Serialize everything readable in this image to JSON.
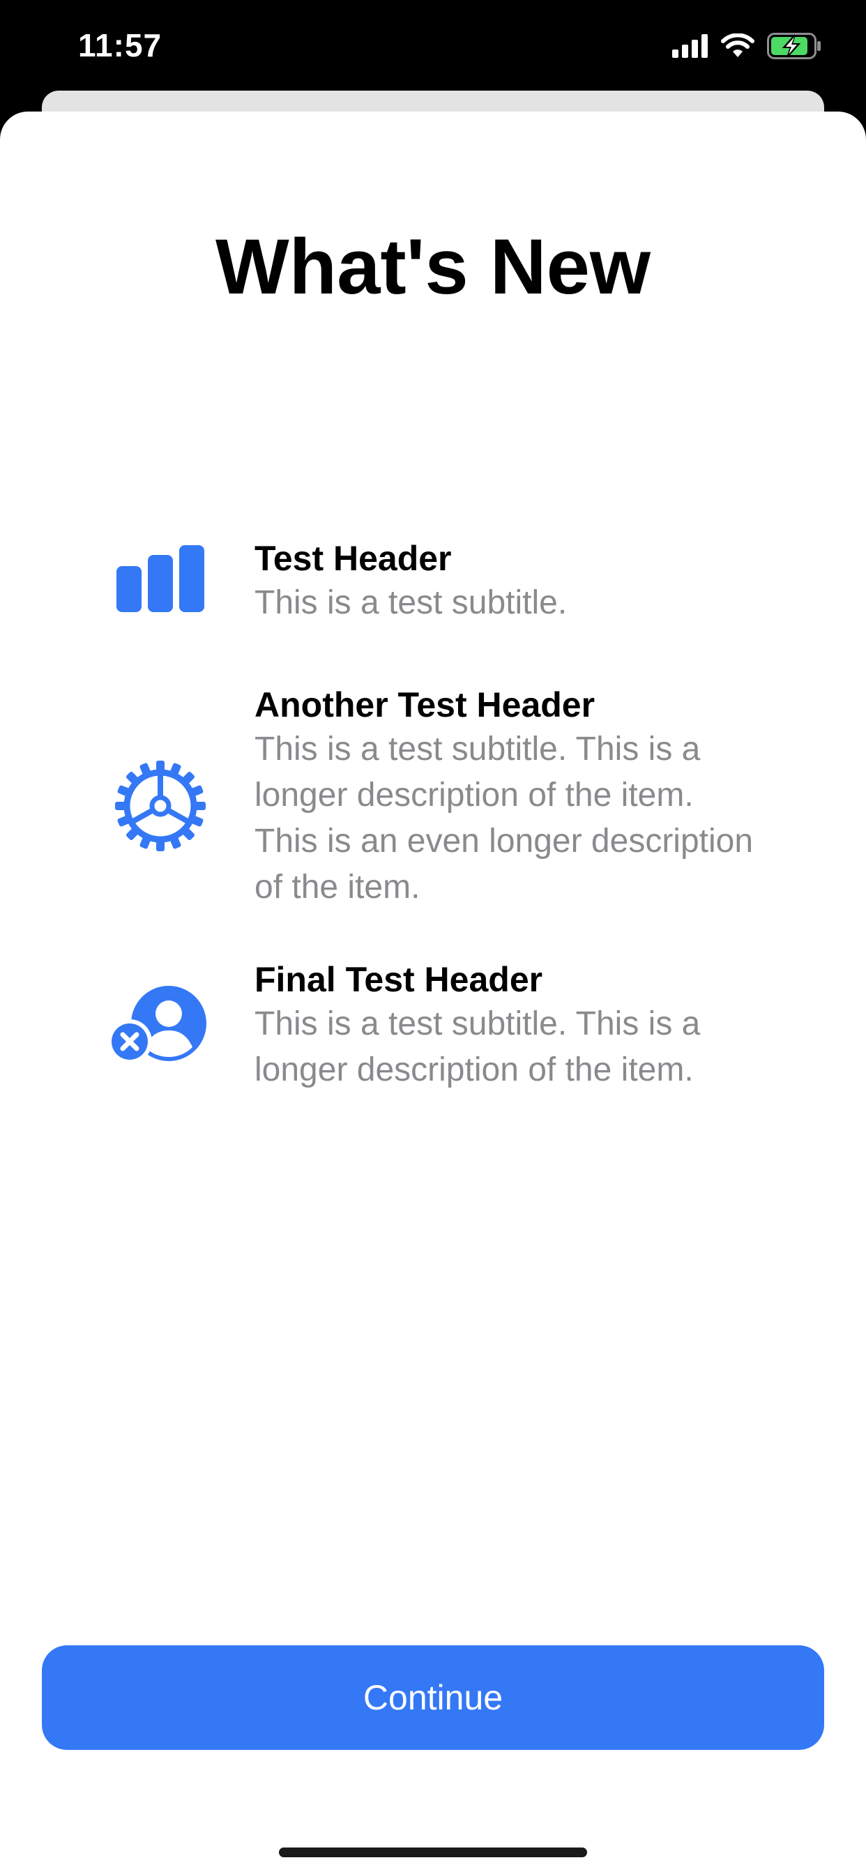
{
  "status_bar": {
    "time": "11:57",
    "icons": [
      "cellular-signal-icon",
      "wifi-icon",
      "battery-charging-icon"
    ]
  },
  "sheet": {
    "title": "What's New",
    "features": [
      {
        "icon": "bar-chart-icon",
        "title": "Test Header",
        "subtitle": "This is a test subtitle."
      },
      {
        "icon": "gear-icon",
        "title": "Another Test Header",
        "subtitle": "This is a test subtitle. This is a longer description of the item. This is an even longer description of the item."
      },
      {
        "icon": "person-crop-circle-badge-xmark-icon",
        "title": "Final Test Header",
        "subtitle": "This is a test subtitle. This is a longer description of the item."
      }
    ],
    "continue_label": "Continue"
  },
  "colors": {
    "accent": "#3478F6",
    "subtitle": "#8A8A8E",
    "battery_fill": "#4CD964"
  }
}
